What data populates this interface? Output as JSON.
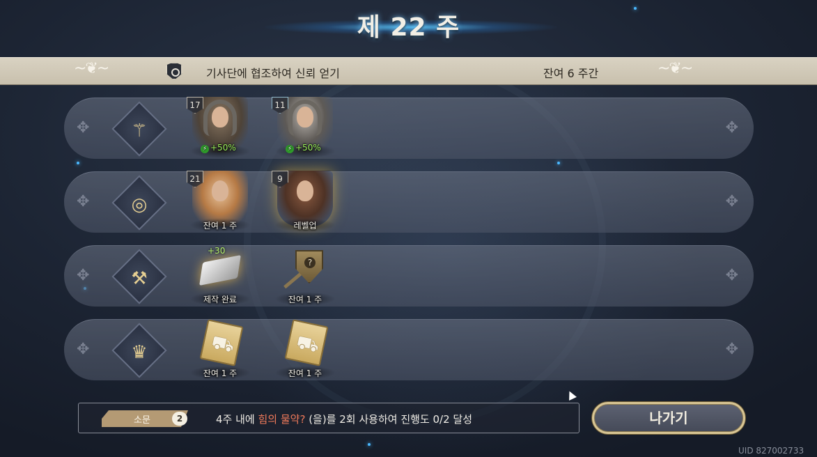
{
  "week": {
    "title": "제 22 주"
  },
  "banner": {
    "objective": "기사단에 협조하여 신뢰 얻기",
    "remaining": "잔여 6 주간"
  },
  "rows": [
    {
      "category_icon": "caduceus-icon",
      "slots": [
        {
          "level": "17",
          "buff": "+50%"
        },
        {
          "level": "11",
          "buff": "+50%"
        }
      ]
    },
    {
      "category_icon": "target-icon",
      "slots": [
        {
          "level": "21",
          "label": "잔여 1 주"
        },
        {
          "level": "9",
          "label": "레벨업"
        }
      ]
    },
    {
      "category_icon": "anvil-icon",
      "slots": [
        {
          "bonus": "+30",
          "label": "제작 완료"
        },
        {
          "label": "잔여 1 주"
        }
      ]
    },
    {
      "category_icon": "crown-icon",
      "slots": [
        {
          "label": "잔여 1 주"
        },
        {
          "label": "잔여 1 주"
        }
      ]
    }
  ],
  "quest": {
    "tab_label": "소문",
    "tab_count": "2",
    "text_prefix": "4주 내에 ",
    "text_highlight": "힘의 물약?",
    "text_suffix": " (을)를 2회 사용하여 진행도 0/2 달성",
    "highlight_color": "#f07a5a"
  },
  "exit_button": "나가기",
  "uid": "UID 827002733"
}
